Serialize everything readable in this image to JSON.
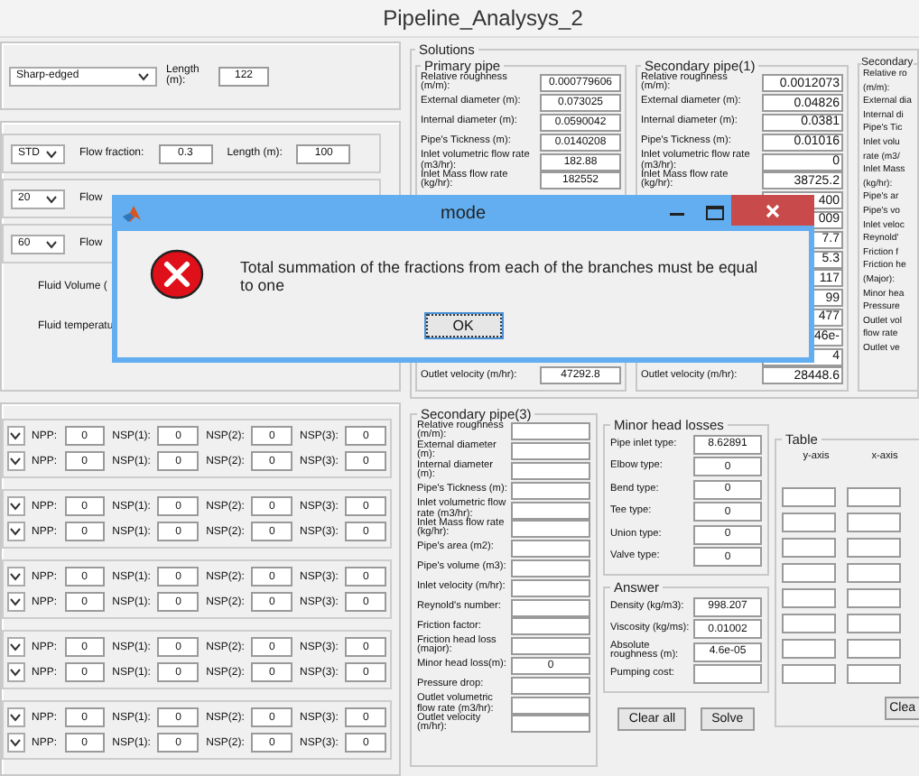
{
  "window": {
    "title": "Pipeline_Analysys_2"
  },
  "entry": {
    "combo": "Sharp-edged",
    "length_label": "Length (m):",
    "length": "122"
  },
  "branches": [
    {
      "combo": "STD",
      "fraction_label": "Flow fraction:",
      "fraction": "0.3",
      "length_label": "Length (m):",
      "length": "100"
    },
    {
      "combo": "20",
      "fraction_label": "Flow"
    },
    {
      "combo": "60",
      "fraction_label": "Flow"
    }
  ],
  "fluid": [
    {
      "label": "Fluid Volume ("
    },
    {
      "label": "Fluid temperatu"
    }
  ],
  "pump_groups": [
    [
      [
        {
          "label": "NPP:",
          "value": "0"
        },
        {
          "label": "NSP(1):",
          "value": "0"
        },
        {
          "label": "NSP(2):",
          "value": "0"
        },
        {
          "label": "NSP(3):",
          "value": "0"
        }
      ],
      [
        {
          "label": "NPP:",
          "value": "0"
        },
        {
          "label": "NSP(1):",
          "value": "0"
        },
        {
          "label": "NSP(2):",
          "value": "0"
        },
        {
          "label": "NSP(3):",
          "value": "0"
        }
      ]
    ],
    [
      [
        {
          "label": "NPP:",
          "value": "0"
        },
        {
          "label": "NSP(1):",
          "value": "0"
        },
        {
          "label": "NSP(2):",
          "value": "0"
        },
        {
          "label": "NSP(3):",
          "value": "0"
        }
      ],
      [
        {
          "label": "NPP:",
          "value": "0"
        },
        {
          "label": "NSP(1):",
          "value": "0"
        },
        {
          "label": "NSP(2):",
          "value": "0"
        },
        {
          "label": "NSP(3):",
          "value": "0"
        }
      ]
    ],
    [
      [
        {
          "label": "NPP:",
          "value": "0"
        },
        {
          "label": "NSP(1):",
          "value": "0"
        },
        {
          "label": "NSP(2):",
          "value": "0"
        },
        {
          "label": "NSP(3):",
          "value": "0"
        }
      ],
      [
        {
          "label": "NPP:",
          "value": "0"
        },
        {
          "label": "NSP(1):",
          "value": "0"
        },
        {
          "label": "NSP(2):",
          "value": "0"
        },
        {
          "label": "NSP(3):",
          "value": "0"
        }
      ]
    ],
    [
      [
        {
          "label": "NPP:",
          "value": "0"
        },
        {
          "label": "NSP(1):",
          "value": "0"
        },
        {
          "label": "NSP(2):",
          "value": "0"
        },
        {
          "label": "NSP(3):",
          "value": "0"
        }
      ],
      [
        {
          "label": "NPP:",
          "value": "0"
        },
        {
          "label": "NSP(1):",
          "value": "0"
        },
        {
          "label": "NSP(2):",
          "value": "0"
        },
        {
          "label": "NSP(3):",
          "value": "0"
        }
      ]
    ],
    [
      [
        {
          "label": "NPP:",
          "value": "0"
        },
        {
          "label": "NSP(1):",
          "value": "0"
        },
        {
          "label": "NSP(2):",
          "value": "0"
        },
        {
          "label": "NSP(3):",
          "value": "0"
        }
      ],
      [
        {
          "label": "NPP:",
          "value": "0"
        },
        {
          "label": "NSP(1):",
          "value": "0"
        },
        {
          "label": "NSP(2):",
          "value": "0"
        },
        {
          "label": "NSP(3):",
          "value": "0"
        }
      ]
    ]
  ],
  "solutions": {
    "title": "Solutions",
    "primary": {
      "title": "Primary pipe",
      "rows": [
        {
          "label": "Relative roughness (m/m):",
          "value": "0.000779606"
        },
        {
          "label": "External diameter (m):",
          "value": "0.073025"
        },
        {
          "label": "Internal diameter (m):",
          "value": "0.0590042"
        },
        {
          "label": "Pipe's Tickness (m):",
          "value": "0.0140208"
        },
        {
          "label": "Inlet volumetric flow rate (m3/hr):",
          "value": "182.88"
        },
        {
          "label": "Inlet Mass flow rate (kg/hr):",
          "value": "182552"
        }
      ],
      "bottom_rows": [
        {
          "label": "Outlet velocity (m/hr):",
          "value": "47292.8"
        }
      ]
    },
    "secondary_1": {
      "title": "Secondary pipe(1)",
      "rows": [
        {
          "label": "Relative roughness (m/m):",
          "value": "0.0012073"
        },
        {
          "label": "External diameter (m):",
          "value": "0.04826"
        },
        {
          "label": "Internal diameter (m):",
          "value": "0.0381"
        },
        {
          "label": "Pipe's Tickness (m):",
          "value": "0.01016"
        },
        {
          "label": "Inlet volumetric flow rate (m3/hr):",
          "value": "0"
        },
        {
          "label": "Inlet Mass flow rate (kg/hr):",
          "value": "38725.2"
        },
        {
          "value": "400"
        },
        {
          "value": "009"
        },
        {
          "value": "7.7"
        },
        {
          "value": "5.3"
        },
        {
          "value": "117"
        },
        {
          "value": "99"
        },
        {
          "value": "477"
        },
        {
          "value": "46e-"
        },
        {
          "value": "4"
        },
        {
          "label": "Outlet velocity (m/hr):",
          "value": "28448.6"
        }
      ]
    },
    "secondary_2": {
      "title": "Secondary",
      "labels": [
        "Relative ro",
        "(m/m):",
        "External dia",
        "Internal di",
        "Pipe's Tic",
        "Inlet volu",
        "rate (m3/",
        "Inlet Mass",
        "(kg/hr):",
        "Pipe's ar",
        "Pipe's vo",
        "Inlet veloc",
        "Reynold'",
        "Friction f",
        "Friction he",
        "(Major):",
        "Minor hea",
        "Pressure",
        "Outlet vol",
        "flow rate",
        "Outlet ve"
      ]
    }
  },
  "secondary_3": {
    "title": "Secondary pipe(3)",
    "rows": [
      {
        "label": "Relative roughness (m/m):"
      },
      {
        "label": "External diameter (m):"
      },
      {
        "label": "Internal diameter (m):"
      },
      {
        "label": "Pipe's Tickness (m):"
      },
      {
        "label": "Inlet volumetric flow rate (m3/hr):"
      },
      {
        "label": "Inlet Mass flow rate (kg/hr):"
      },
      {
        "label": "Pipe's area (m2):"
      },
      {
        "label": "Pipe's volume (m3):"
      },
      {
        "label": "Inlet velocity (m/hr):"
      },
      {
        "label": "Reynold's number:"
      },
      {
        "label": "Friction factor:"
      },
      {
        "label": "Friction head loss (major):"
      },
      {
        "label": "Minor head loss(m):",
        "value": "0"
      },
      {
        "label": "Pressure drop:"
      },
      {
        "label": "Outlet volumetric flow rate (m3/hr):"
      },
      {
        "label": "Outlet velocity (m/hr):"
      }
    ]
  },
  "minor_head_losses": {
    "title": "Minor head losses",
    "rows": [
      {
        "label": "Pipe inlet type:",
        "value": "8.62891"
      },
      {
        "label": "Elbow type:",
        "value": "0"
      },
      {
        "label": "Bend type:",
        "value": "0"
      },
      {
        "label": "Tee type:",
        "value": "0"
      },
      {
        "label": "Union type:",
        "value": "0"
      },
      {
        "label": "Valve type:",
        "value": "0"
      }
    ]
  },
  "answer": {
    "title": "Answer",
    "rows": [
      {
        "label": "Density (kg/m3):",
        "value": "998.207"
      },
      {
        "label": "Viscosity (kg/ms):",
        "value": "0.01002"
      },
      {
        "label": "Absolute roughness (m):",
        "value": "4.6e-05"
      },
      {
        "label": "Pumping cost:"
      }
    ]
  },
  "buttons": [
    "Clear all",
    "Solve"
  ],
  "table": {
    "title": "Table",
    "columns": [
      "y-axis",
      "x-axis"
    ],
    "clear_button": "Clea"
  },
  "dialog": {
    "title": "mode",
    "message": "Total summation of the fractions from each of the branches must be equal to one",
    "button": "OK"
  }
}
